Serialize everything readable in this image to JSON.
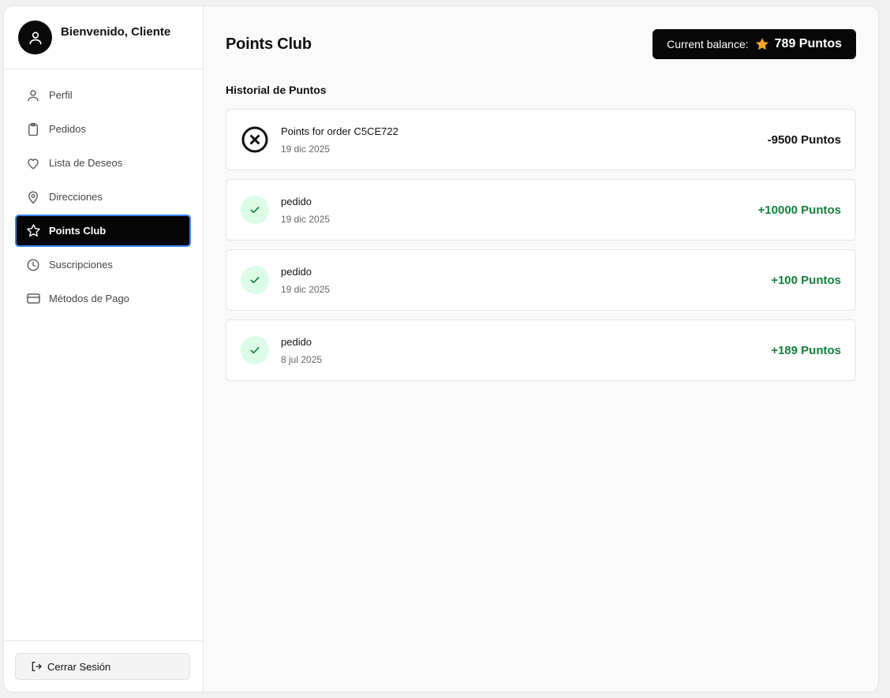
{
  "sidebar": {
    "welcome": "Bienvenido, Cliente",
    "items": [
      {
        "label": "Perfil",
        "icon": "user-icon"
      },
      {
        "label": "Pedidos",
        "icon": "clipboard-icon"
      },
      {
        "label": "Lista de Deseos",
        "icon": "heart-icon"
      },
      {
        "label": "Direcciones",
        "icon": "map-pin-icon"
      },
      {
        "label": "Points Club",
        "icon": "star-icon",
        "active": true
      },
      {
        "label": "Suscripciones",
        "icon": "clock-icon"
      },
      {
        "label": "Métodos de Pago",
        "icon": "credit-card-icon"
      }
    ],
    "logout_label": "Cerrar Sesión"
  },
  "main": {
    "title": "Points Club",
    "balance": {
      "label": "Current balance:",
      "amount": "789 Puntos"
    },
    "history_title": "Historial de Puntos",
    "history": [
      {
        "description": "Points for order C5CE722",
        "date": "19 dic 2025",
        "points": "-9500 Puntos",
        "status": "cancelled"
      },
      {
        "description": "pedido",
        "date": "19 dic 2025",
        "points": "+10000 Puntos",
        "status": "ok"
      },
      {
        "description": "pedido",
        "date": "19 dic 2025",
        "points": "+100 Puntos",
        "status": "ok"
      },
      {
        "description": "pedido",
        "date": "8 jul 2025",
        "points": "+189 Puntos",
        "status": "ok"
      }
    ]
  },
  "colors": {
    "accent": "#050505",
    "positive": "#15803d",
    "positive_bg": "#dcfce7",
    "focus": "#3b82f6",
    "star": "#f5a623"
  }
}
